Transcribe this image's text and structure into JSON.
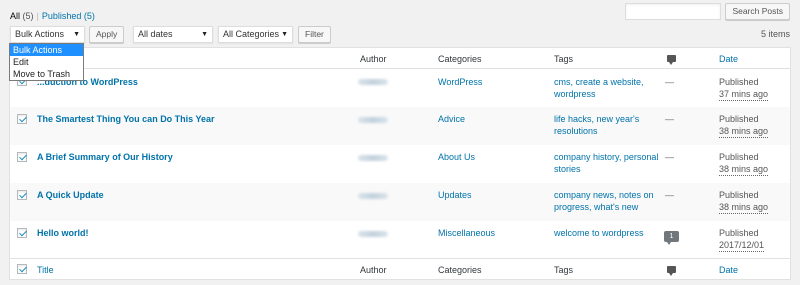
{
  "views": {
    "all_label": "All",
    "all_count": "(5)",
    "separator": "|",
    "published_label": "Published",
    "published_count": "(5)"
  },
  "search": {
    "value": "",
    "button_label": "Search Posts"
  },
  "toolbar": {
    "bulk_actions": "Bulk Actions",
    "apply_label": "Apply",
    "dates_filter": "All dates",
    "categories_filter": "All Categories",
    "filter_label": "Filter",
    "items_count": "5 items"
  },
  "bulk_dropdown": {
    "options": [
      "Bulk Actions",
      "Edit",
      "Move to Trash"
    ],
    "selected_index": 0
  },
  "columns": {
    "title": "Title",
    "author": "Author",
    "categories": "Categories",
    "tags": "Tags",
    "comments_icon": "comment-icon",
    "date": "Date"
  },
  "rows": [
    {
      "title": "An Introduction to WordPress",
      "visible_title": "...duction to WordPress",
      "categories": "WordPress",
      "tags_line1": "cms, create a website,",
      "tags_line2": "wordpress",
      "comments": "—",
      "status": "Published",
      "date": "37 mins ago",
      "checked": true
    },
    {
      "title": "The Smartest Thing You can Do This Year",
      "categories": "Advice",
      "tags_line1": "life hacks, new year's",
      "tags_line2": "resolutions",
      "comments": "—",
      "status": "Published",
      "date": "38 mins ago",
      "checked": true
    },
    {
      "title": "A Brief Summary of Our History",
      "categories": "About Us",
      "tags_line1": "company history, personal",
      "tags_line2": "stories",
      "comments": "—",
      "status": "Published",
      "date": "38 mins ago",
      "checked": true
    },
    {
      "title": "A Quick Update",
      "categories": "Updates",
      "tags_line1": "company news, notes on",
      "tags_line2": "progress, what's new",
      "comments": "—",
      "status": "Published",
      "date": "38 mins ago",
      "checked": true
    },
    {
      "title": "Hello world!",
      "categories": "Miscellaneous",
      "tags_line1": "welcome to wordpress",
      "tags_line2": "",
      "comments": "1",
      "status": "Published",
      "date": "2017/12/01",
      "checked": true
    }
  ],
  "colors": {
    "link": "#0073aa",
    "checkbox_check": "#1e8cbe",
    "dropdown_highlight": "#1e90ff",
    "background": "#f1f1f1"
  }
}
